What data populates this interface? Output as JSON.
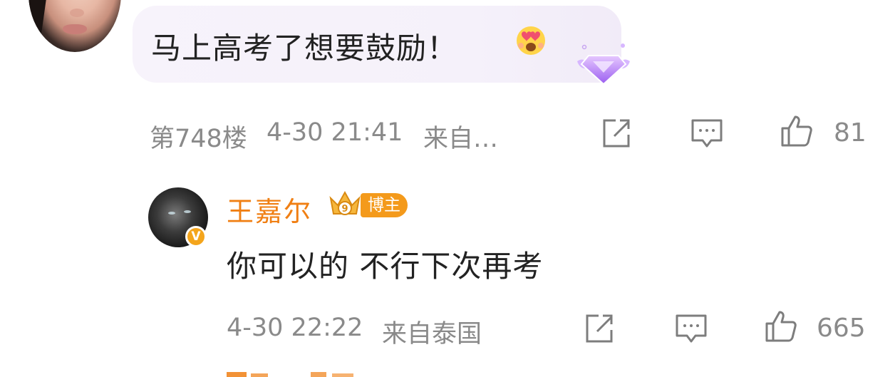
{
  "top_comment": {
    "text": "马上高考了想要鼓励！",
    "emoji": "heart-eyes-emoji",
    "badge": "diamond-fan-badge",
    "floor_label": "第748楼",
    "timestamp": "4-30 21:41",
    "source": "来自…",
    "like_count": "81"
  },
  "reply": {
    "author": "王嘉尔",
    "host_tag": "博主",
    "verified_badge": "V",
    "text": "你可以的 不行下次再考",
    "timestamp": "4-30 22:22",
    "source": "来自泰国",
    "like_count": "665"
  },
  "icons": {
    "share": "share-icon",
    "comment": "comment-icon",
    "like": "thumbs-up-icon"
  },
  "colors": {
    "author_name": "#f07f13",
    "meta_gray": "#8a8a8a",
    "bubble_bg": "#f6f2fa",
    "host_tag_bg": "#f49a1b",
    "verified_badge": "#f4a51c"
  }
}
